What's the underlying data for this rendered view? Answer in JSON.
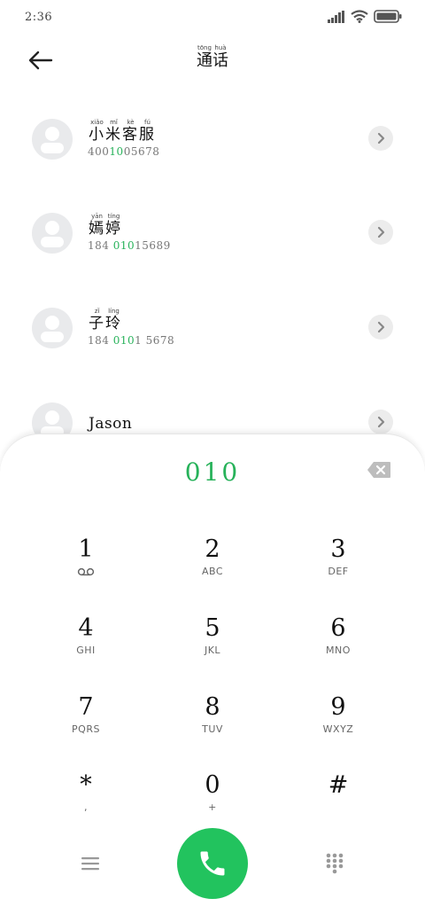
{
  "status_bar": {
    "time": "2:36",
    "icons": [
      "signal-icon",
      "wifi-icon",
      "battery-icon"
    ]
  },
  "header": {
    "title_chars": [
      {
        "char": "通",
        "pinyin": "tōng"
      },
      {
        "char": "话",
        "pinyin": "huà"
      }
    ],
    "back_icon": "arrow-left-icon"
  },
  "contacts": [
    {
      "name_chars": [
        {
          "char": "小",
          "pinyin": "xiǎo"
        },
        {
          "char": "米",
          "pinyin": "mǐ"
        },
        {
          "char": "客",
          "pinyin": "kè"
        },
        {
          "char": "服",
          "pinyin": "fú"
        }
      ],
      "number_before": "400",
      "number_match": "10",
      "number_after": "05678"
    },
    {
      "name_chars": [
        {
          "char": "嫣",
          "pinyin": "yān"
        },
        {
          "char": "婷",
          "pinyin": "tíng"
        }
      ],
      "number_before": "184 ",
      "number_match": "010",
      "number_after": "15689"
    },
    {
      "name_chars": [
        {
          "char": "子",
          "pinyin": "zǐ"
        },
        {
          "char": "玲",
          "pinyin": "líng"
        }
      ],
      "number_before": "184 ",
      "number_match": "010",
      "number_after": "1 5678"
    },
    {
      "name_plain": "Jason",
      "number_before": "",
      "number_match": "",
      "number_after": ""
    }
  ],
  "dialpad": {
    "dialed_number": "010",
    "keys": [
      {
        "digit": "1",
        "letters": "",
        "voicemail": true
      },
      {
        "digit": "2",
        "letters": "ABC"
      },
      {
        "digit": "3",
        "letters": "DEF"
      },
      {
        "digit": "4",
        "letters": "GHI"
      },
      {
        "digit": "5",
        "letters": "JKL"
      },
      {
        "digit": "6",
        "letters": "MNO"
      },
      {
        "digit": "7",
        "letters": "PQRS"
      },
      {
        "digit": "8",
        "letters": "TUV"
      },
      {
        "digit": "9",
        "letters": "WXYZ"
      },
      {
        "digit": "*",
        "letters": ","
      },
      {
        "digit": "0",
        "letters": "+"
      },
      {
        "digit": "#",
        "letters": ""
      }
    ]
  },
  "colors": {
    "accent_green": "#27b25a",
    "call_button": "#22c35e",
    "avatar_bg": "#e9eaec"
  }
}
